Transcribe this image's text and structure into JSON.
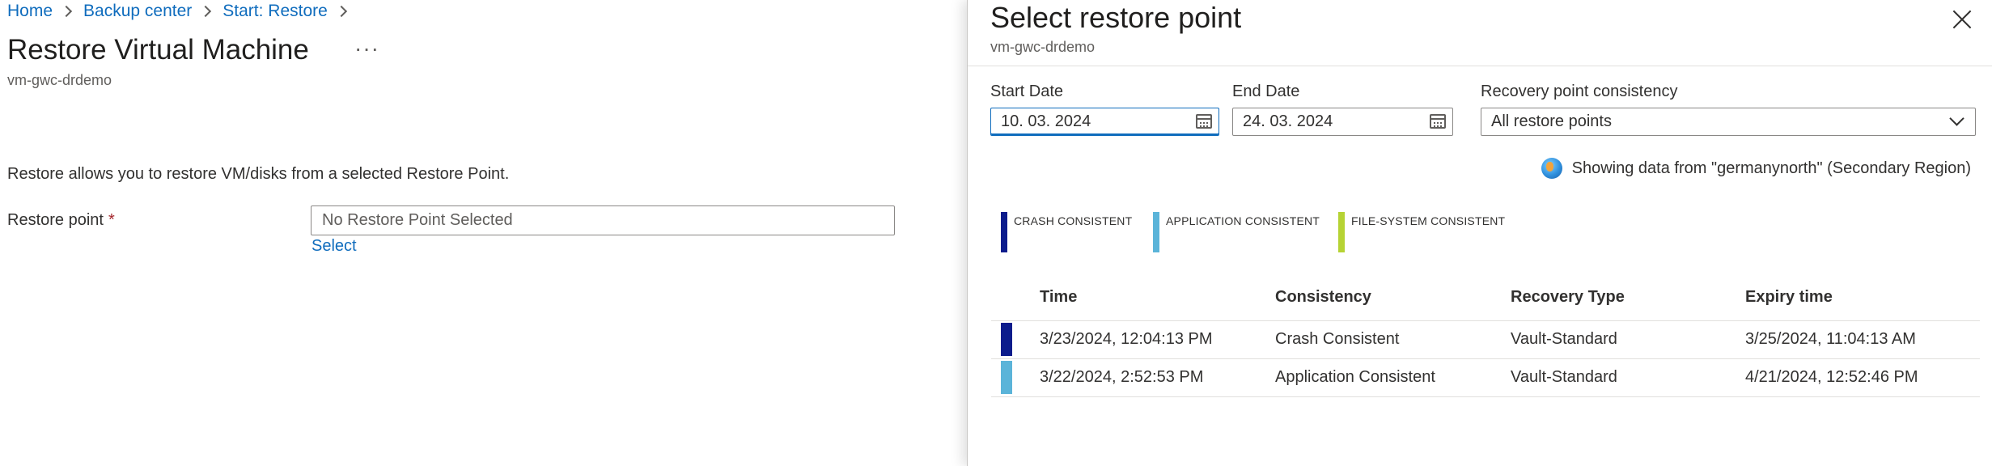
{
  "left_blade": {
    "breadcrumb": [
      "Home",
      "Backup center",
      "Start: Restore"
    ],
    "title": "Restore Virtual Machine",
    "more_label": "···",
    "subtitle": "vm-gwc-drdemo",
    "description": "Restore allows you to restore VM/disks from a selected Restore Point.",
    "restore_point_label": "Restore point",
    "required_mark": "*",
    "restore_point_value": "No Restore Point Selected",
    "select_link": "Select"
  },
  "panel": {
    "title": "Select restore point",
    "subtitle": "vm-gwc-drdemo",
    "close_icon": "close-icon",
    "start_date": {
      "label": "Start Date",
      "value": "10. 03. 2024"
    },
    "end_date": {
      "label": "End Date",
      "value": "24. 03. 2024"
    },
    "consistency_filter": {
      "label": "Recovery point consistency",
      "value": "All restore points"
    },
    "region_icon": "globe-icon",
    "region_note": "Showing data from \"germanynorth\" (Secondary Region)",
    "legend": [
      {
        "label": "CRASH CONSISTENT",
        "color": "#0c1c8c"
      },
      {
        "label": "APPLICATION CONSISTENT",
        "color": "#5bb4d9"
      },
      {
        "label": "FILE-SYSTEM CONSISTENT",
        "color": "#b6d334"
      }
    ],
    "table": {
      "columns": [
        "Time",
        "Consistency",
        "Recovery Type",
        "Expiry time"
      ],
      "rows": [
        {
          "color": "#0c1c8c",
          "time": "3/23/2024, 12:04:13 PM",
          "consistency": "Crash Consistent",
          "recovery_type": "Vault-Standard",
          "expiry": "3/25/2024, 11:04:13 AM"
        },
        {
          "color": "#5bb4d9",
          "time": "3/22/2024, 2:52:53 PM",
          "consistency": "Application Consistent",
          "recovery_type": "Vault-Standard",
          "expiry": "4/21/2024, 12:52:46 PM"
        }
      ]
    }
  }
}
